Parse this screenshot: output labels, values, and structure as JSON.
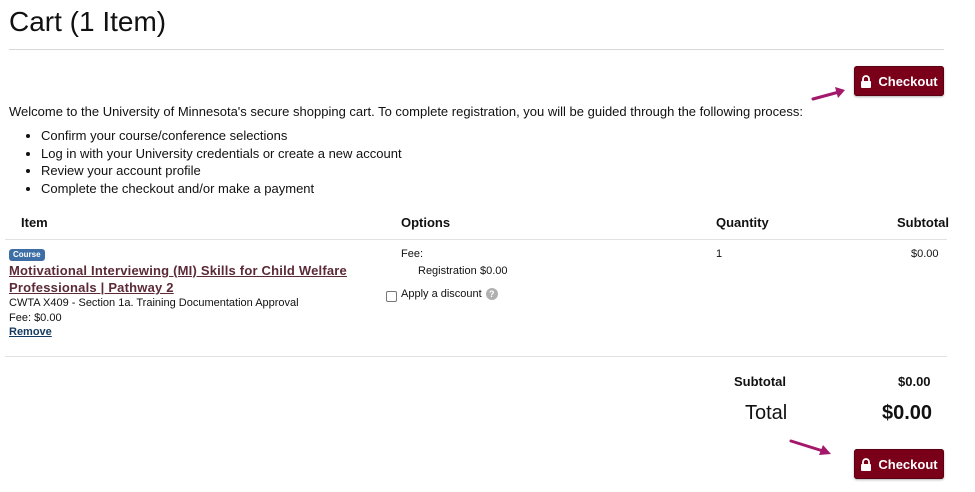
{
  "page": {
    "title": "Cart (1 Item)"
  },
  "checkout": {
    "label": "Checkout"
  },
  "intro": "Welcome to the University of Minnesota's secure shopping cart. To complete registration, you will be guided through the following process:",
  "steps": [
    "Confirm your course/conference selections",
    "Log in with your University credentials or create a new account",
    "Review your account profile",
    "Complete the checkout and/or make a payment"
  ],
  "table": {
    "headers": {
      "item": "Item",
      "options": "Options",
      "quantity": "Quantity",
      "subtotal": "Subtotal"
    },
    "row": {
      "badge": "Course",
      "title": "Motivational Interviewing (MI) Skills for Child Welfare Professionals | Pathway 2",
      "section": "CWTA X409 - Section 1a. Training Documentation Approval",
      "fee_line": "Fee: $0.00",
      "remove": "Remove",
      "fee_label": "Fee:",
      "registration_label": "Registration",
      "registration_amount": "$0.00",
      "discount_label": "Apply a discount",
      "help_icon": "?",
      "quantity": "1",
      "subtotal": "$0.00"
    }
  },
  "totals": {
    "subtotal_label": "Subtotal",
    "subtotal_value": "$0.00",
    "total_label": "Total",
    "total_value": "$0.00"
  },
  "colors": {
    "brand": "#7a0019",
    "arrow": "#a3186a",
    "link": "#5b2a36",
    "badge": "#3d6fa6"
  }
}
